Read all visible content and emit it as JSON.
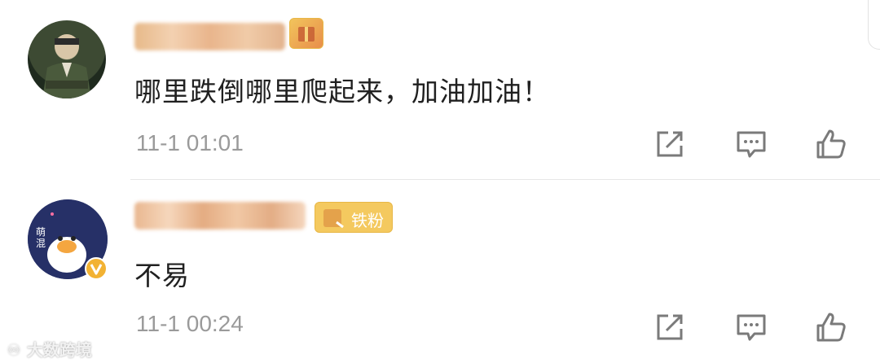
{
  "comments": [
    {
      "content": "哪里跌倒哪里爬起来，加油加油！",
      "time": "11-1 01:01",
      "badge_text": ""
    },
    {
      "content": "不易",
      "time": "11-1 00:24",
      "badge_text": "铁粉"
    }
  ],
  "icons": {
    "share": "share-icon",
    "reply": "comment-reply-icon",
    "like": "thumbs-up-icon",
    "verified": "verified-badge-icon"
  },
  "watermark": "大数跨境",
  "colors": {
    "text": "#202020",
    "meta": "#9a9a9a",
    "icon": "#777777",
    "badge": "#f4c95f",
    "verified": "#f2b233"
  }
}
